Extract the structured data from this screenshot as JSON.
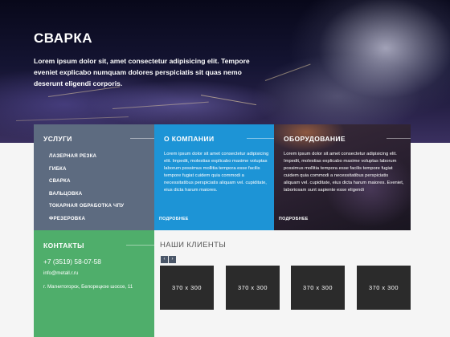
{
  "hero": {
    "title": "СВАРКА",
    "text": "Lorem ipsum dolor sit, amet consectetur adipisicing elit. Tempore eveniet explicabo numquam dolores perspiciatis sit quas nemo deserunt eligendi corporis."
  },
  "services": {
    "title": "УСЛУГИ",
    "items": [
      "ЛАЗЕРНАЯ РЕЗКА",
      "ГИБКА",
      "СВАРКА",
      "ВАЛЬЦОВКА",
      "ТОКАРНАЯ ОБРАБОТКА ЧПУ",
      "ФРЕЗЕРОВКА"
    ]
  },
  "about": {
    "title": "О КОМПАНИИ",
    "text": "Lorem ipsum dolor sit amet consectetur adipisicing elit. Impedit, molestias explicabo maxime voluptas laborum possimus mollitia tempora esse facilis tempore fugiat cuidem quia commodi a necessitatibus perspiciatis aliquam vel. cupiditate, eius dicta harum maiores.",
    "more": "ПОДРОБНЕЕ"
  },
  "equipment": {
    "title": "ОБОРУДОВАНИЕ",
    "text": "Lorem ipsum dolor sit amet consectetur adipisicing elit. Impedit, molestias explicabo maxime voluptas laborum possimus mollitia tempora esse facilis tempore fugiat cuidem quia commodi a necessitatibus perspiciatis aliquam vel. cupiditate, eius dicta harum maiores. Eveniet, laboriosam sunt sapiente esse eligendi",
    "more": "ПОДРОБНЕЕ"
  },
  "contacts": {
    "title": "КОНТАКТЫ",
    "phone": "+7 (3519) 58-07-58",
    "email": "info@metall.r.ru",
    "address": "г. Магнитогорск, Белорецкое шоссе, 11"
  },
  "clients": {
    "title": "НАШИ КЛИЕНТЫ",
    "prev_icon": "‹",
    "next_icon": "›",
    "items": [
      "370 x 300",
      "370 x 300",
      "370 x 300",
      "370 x 300"
    ]
  },
  "colors": {
    "services_tile": "#5d6b80",
    "about_tile": "#1d94d6",
    "contacts_tile": "#4fae6b",
    "client_placeholder": "#2b2b2b"
  }
}
